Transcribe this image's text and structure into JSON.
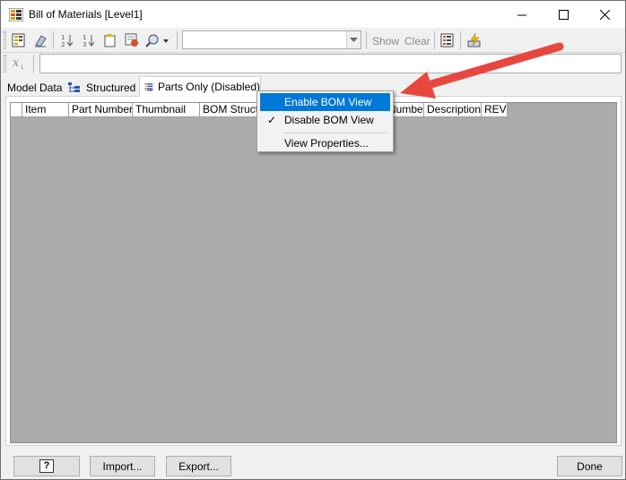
{
  "window": {
    "title": "Bill of Materials [Level1]"
  },
  "toolbar": {
    "show_label": "Show",
    "clear_label": "Clear",
    "combo_value": ""
  },
  "formula": {
    "icon_text": "x",
    "value": ""
  },
  "tabs": [
    {
      "label": "Model Data"
    },
    {
      "label": "Structured"
    },
    {
      "label": "Parts Only (Disabled)"
    }
  ],
  "grid": {
    "columns": [
      "",
      "Item",
      "Part Number",
      "Thumbnail",
      "BOM Structure",
      "",
      "",
      "Number",
      "Description",
      "REV"
    ]
  },
  "context_menu": {
    "items": [
      {
        "label": "Enable BOM View",
        "checked": false,
        "highlighted": true
      },
      {
        "label": "Disable BOM View",
        "checked": true,
        "highlighted": false
      },
      {
        "label": "View Properties...",
        "checked": false,
        "highlighted": false
      }
    ]
  },
  "buttons": {
    "help_icon": "?",
    "import_label": "Import...",
    "export_label": "Export...",
    "done_label": "Done"
  },
  "colors": {
    "highlight": "#0078d7",
    "annotation_arrow": "#e8473f",
    "grid_background": "#ababab"
  }
}
